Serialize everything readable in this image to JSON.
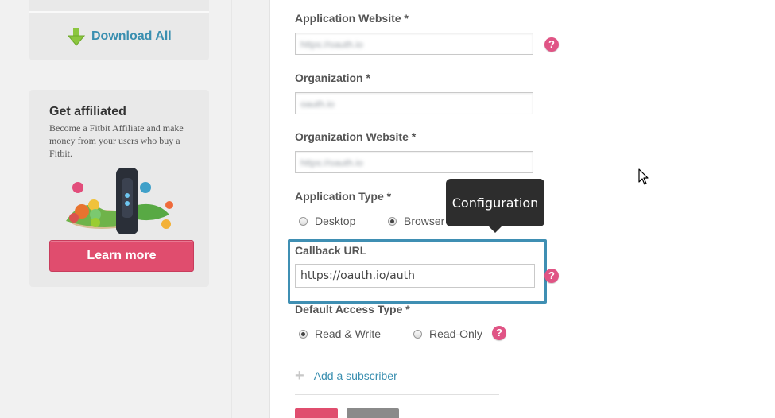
{
  "sidebar": {
    "download_label": "Download All",
    "affiliate": {
      "title": "Get affiliated",
      "description": "Become a Fitbit Affiliate and make money from your users who buy a Fitbit.",
      "button_label": "Learn more"
    }
  },
  "form": {
    "app_website": {
      "label": "Application Website *",
      "value": "https://oauth.io"
    },
    "organization": {
      "label": "Organization *",
      "value": "oauth.io"
    },
    "org_website": {
      "label": "Organization Website *",
      "value": "https://oauth.io"
    },
    "app_type": {
      "label": "Application Type *",
      "options": [
        {
          "label": "Desktop",
          "checked": false
        },
        {
          "label": "Browser",
          "checked": true
        }
      ]
    },
    "callback_url": {
      "label": "Callback URL",
      "value": "https://oauth.io/auth"
    },
    "default_access": {
      "label": "Default Access Type *",
      "options": [
        {
          "label": "Read & Write",
          "checked": true
        },
        {
          "label": "Read-Only",
          "checked": false
        }
      ]
    },
    "add_subscriber_label": "Add a subscriber",
    "help_glyph": "?"
  },
  "tooltip": {
    "text": "Configuration"
  },
  "icons": [
    "download-arrow-icon",
    "help-icon",
    "plus-icon",
    "mouse-cursor-icon"
  ],
  "colors": {
    "accent_blue": "#3a8fb0",
    "pink": "#e04d6e",
    "highlight": "#3f8fb3",
    "tooltip_bg": "#2d2d2d"
  }
}
